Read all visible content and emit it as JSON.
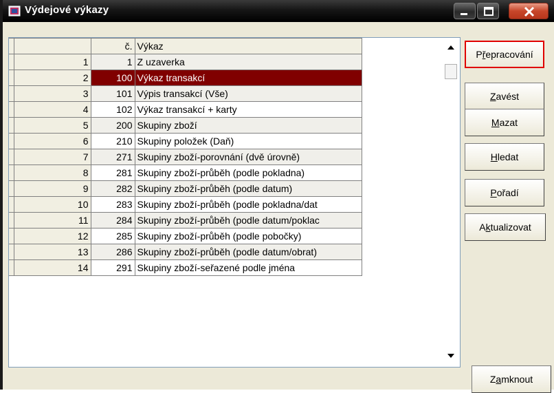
{
  "window": {
    "title": "Výdejové výkazy",
    "colors": {
      "selected_row": "#800000",
      "close_button": "#c7462a",
      "focus_border": "#e00000"
    }
  },
  "table": {
    "headers": {
      "index": "",
      "number": "č.",
      "report": "Výkaz"
    },
    "selected_index": 1,
    "rows": [
      {
        "index": "1",
        "number": "1",
        "report": "Z uzaverka"
      },
      {
        "index": "2",
        "number": "100",
        "report": "Výkaz transakcí"
      },
      {
        "index": "3",
        "number": "101",
        "report": "Výpis transakcí (Vše)"
      },
      {
        "index": "4",
        "number": "102",
        "report": "Výkaz transakcí + karty"
      },
      {
        "index": "5",
        "number": "200",
        "report": "Skupiny zboží"
      },
      {
        "index": "6",
        "number": "210",
        "report": "Skupiny položek (Daň)"
      },
      {
        "index": "7",
        "number": "271",
        "report": "Skupiny zboží-porovnání (dvě úrovně)"
      },
      {
        "index": "8",
        "number": "281",
        "report": "Skupiny zboží-průběh (podle pokladna)"
      },
      {
        "index": "9",
        "number": "282",
        "report": "Skupiny zboží-průběh (podle datum)"
      },
      {
        "index": "10",
        "number": "283",
        "report": "Skupiny zboží-průběh (podle pokladna/dat"
      },
      {
        "index": "11",
        "number": "284",
        "report": "Skupiny zboží-průběh (podle datum/poklac"
      },
      {
        "index": "12",
        "number": "285",
        "report": "Skupiny zboží-průběh (podle pobočky)"
      },
      {
        "index": "13",
        "number": "286",
        "report": "Skupiny zboží-průběh (podle datum/obrat)"
      },
      {
        "index": "14",
        "number": "291",
        "report": "Skupiny zboží-seřazené podle jména"
      }
    ]
  },
  "buttons": {
    "prepracovani": {
      "before": "P",
      "key": "ř",
      "after": "epracování"
    },
    "zavest": {
      "before": "",
      "key": "Z",
      "after": "avést"
    },
    "mazat": {
      "before": "",
      "key": "M",
      "after": "azat"
    },
    "hledat": {
      "before": "",
      "key": "H",
      "after": "ledat"
    },
    "poradi": {
      "before": "",
      "key": "P",
      "after": "ořadí"
    },
    "aktualizovat": {
      "before": "A",
      "key": "k",
      "after": "tualizovat"
    },
    "zamknout": {
      "before": "Z",
      "key": "a",
      "after": "mknout"
    }
  }
}
